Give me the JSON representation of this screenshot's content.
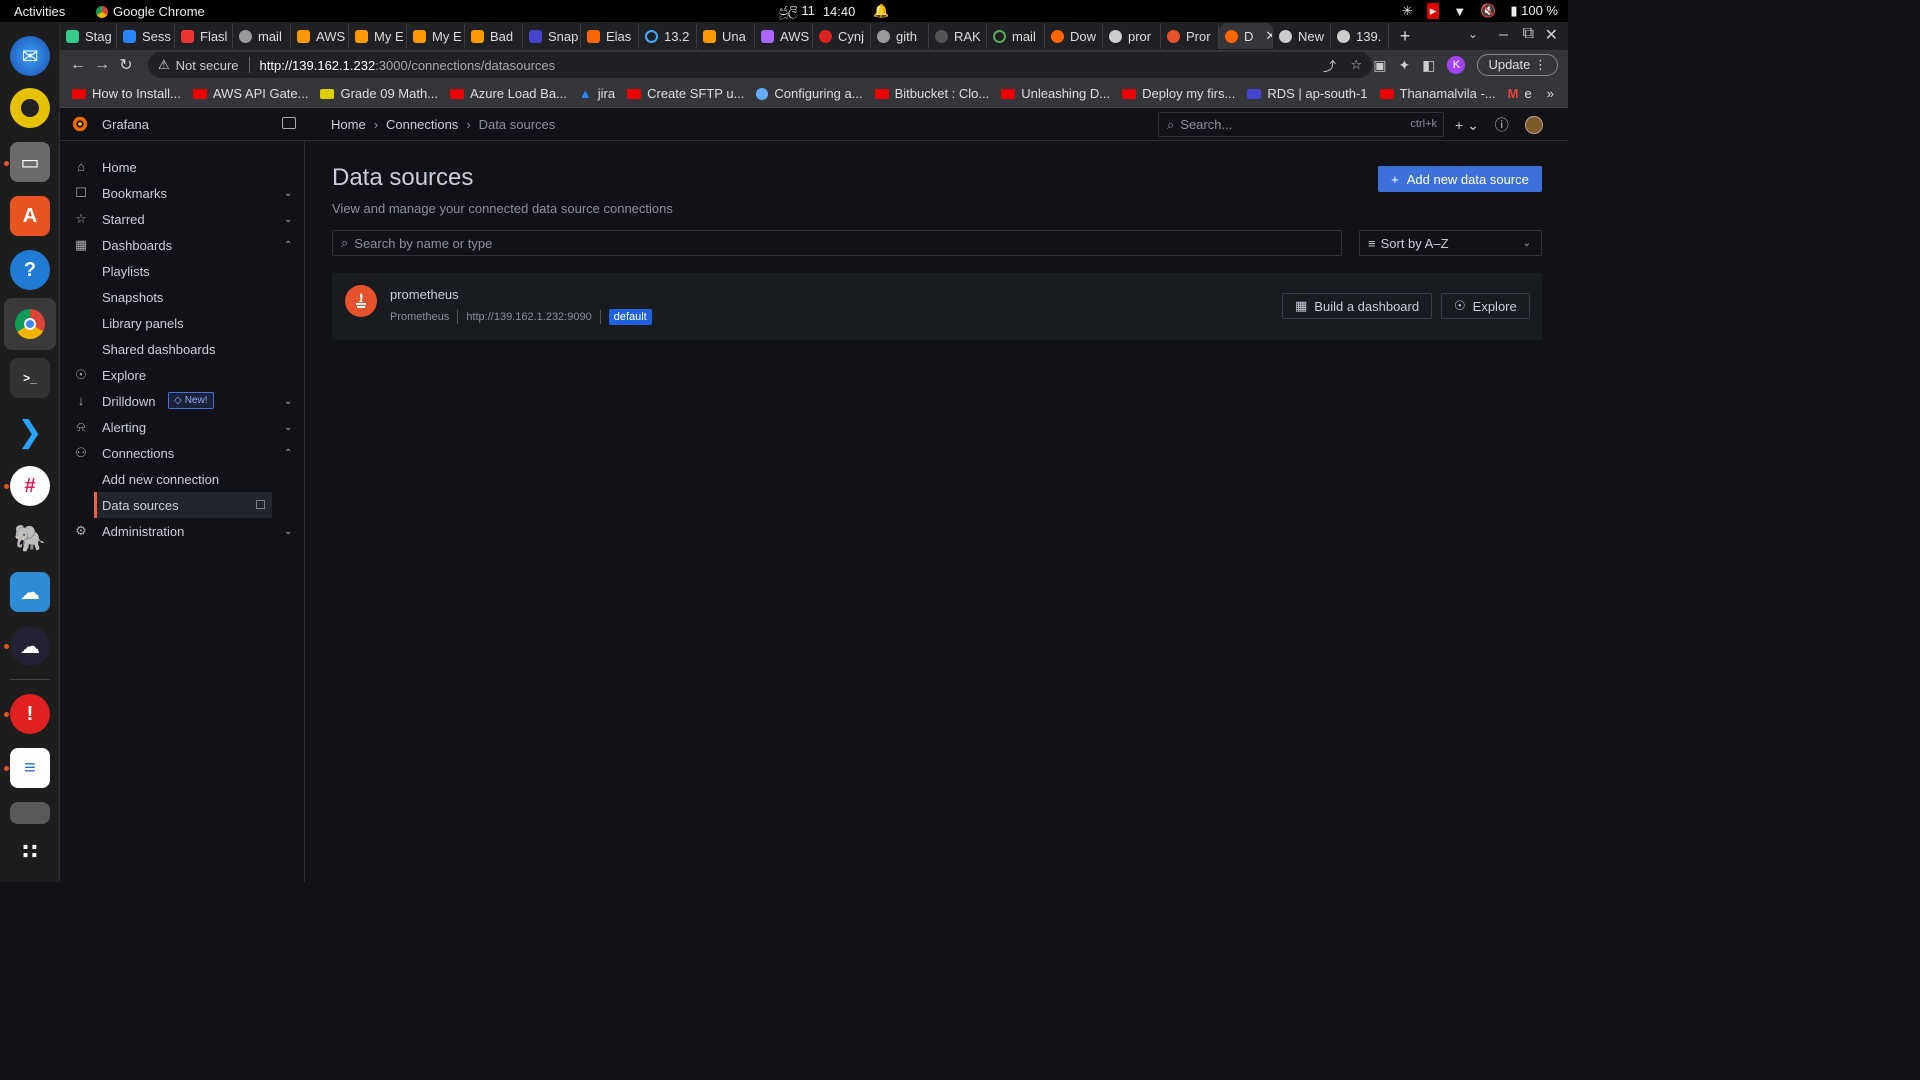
{
  "os": {
    "activities": "Activities",
    "app_name": "Google Chrome",
    "date": "ජූලි 11",
    "time": "14:40",
    "battery": "100 %"
  },
  "tabs": [
    "Stag",
    "Sess",
    "Flasl",
    "mail",
    "AWS",
    "My E",
    "My E",
    "Bad",
    "Snap",
    "Elas",
    "13.2",
    "Una",
    "AWS",
    "Cynj",
    "gith",
    "RAK",
    "mail",
    "Dow",
    "pror",
    "Pror",
    "D",
    "New",
    "139."
  ],
  "browser": {
    "not_secure": "Not secure",
    "url_host": "http://139.162.1.232",
    "url_path": ":3000/connections/datasources",
    "update": "Update",
    "profile_initial": "K"
  },
  "bookmarks": [
    "How to Install...",
    "AWS API Gate...",
    "Grade 09 Math...",
    "Azure Load Ba...",
    "jira",
    "Create SFTP u...",
    "Configuring a...",
    "Bitbucket : Clo...",
    "Unleashing D...",
    "Deploy my firs...",
    "RDS | ap-south-1",
    "Thanamalvila -...",
    "e"
  ],
  "grafana": {
    "title": "Grafana",
    "breadcrumbs": [
      "Home",
      "Connections",
      "Data sources"
    ],
    "search_placeholder": "Search...",
    "search_shortcut": "ctrl+k"
  },
  "sidebar": {
    "home": "Home",
    "bookmarks": "Bookmarks",
    "starred": "Starred",
    "dashboards": "Dashboards",
    "playlists": "Playlists",
    "snapshots": "Snapshots",
    "library_panels": "Library panels",
    "shared_dashboards": "Shared dashboards",
    "explore": "Explore",
    "drilldown": "Drilldown",
    "new_badge": "New!",
    "alerting": "Alerting",
    "connections": "Connections",
    "add_new_connection": "Add new connection",
    "data_sources": "Data sources",
    "administration": "Administration"
  },
  "main": {
    "title": "Data sources",
    "subtitle": "View and manage your connected data source connections",
    "add_button": "Add new data source",
    "search_placeholder": "Search by name or type",
    "sort_label": "Sort by A–Z"
  },
  "datasource": {
    "name": "prometheus",
    "type": "Prometheus",
    "url": "http://139.162.1.232:9090",
    "badge": "default",
    "build_button": "Build a dashboard",
    "explore_button": "Explore"
  },
  "colors": {
    "accent": "#3d71d9",
    "active_bar": "#f55f3e",
    "prometheus": "#e6522c"
  }
}
